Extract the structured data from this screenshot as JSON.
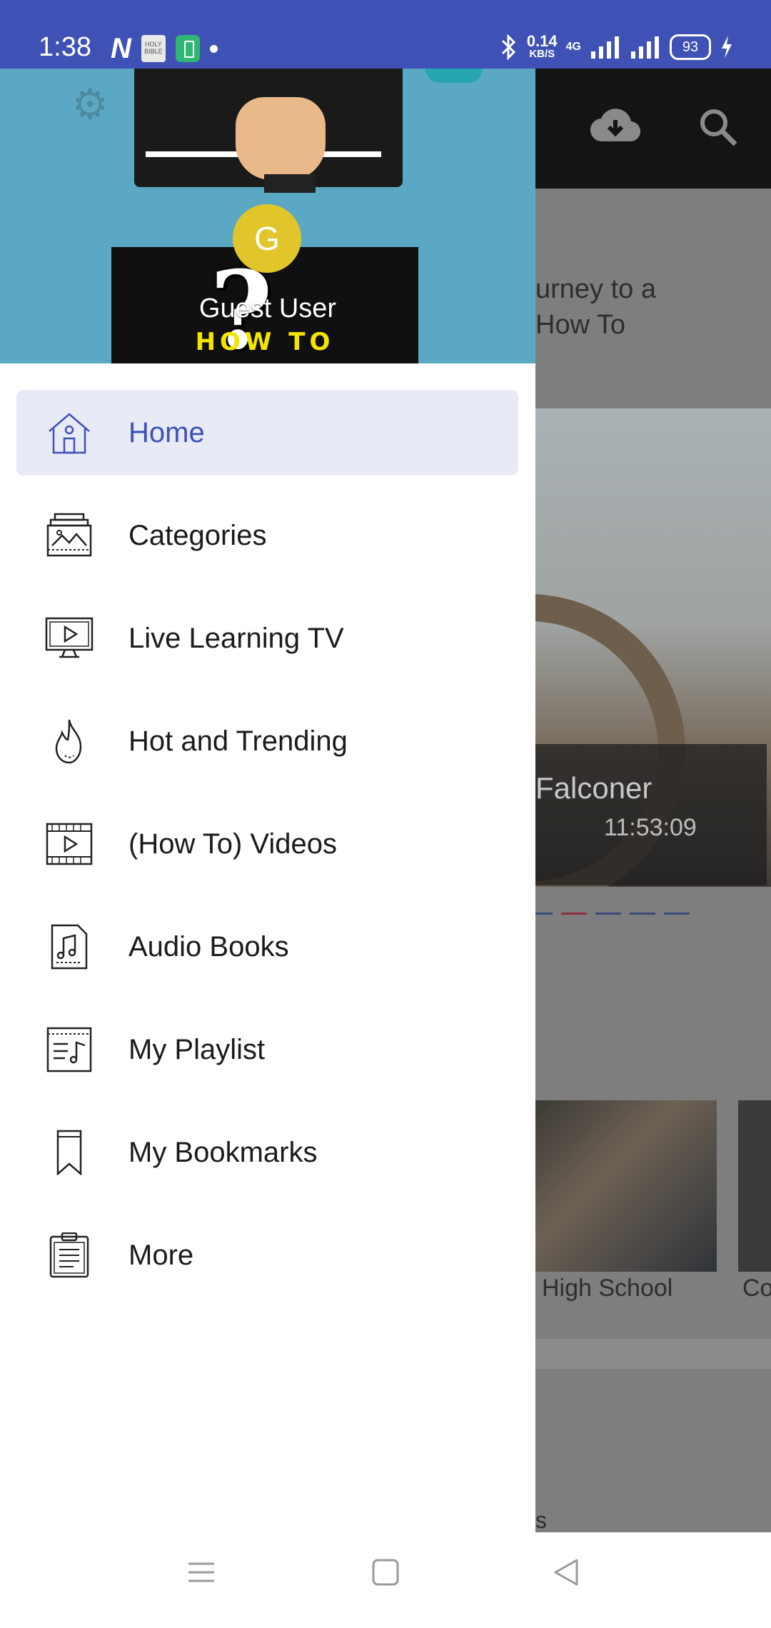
{
  "status_bar": {
    "time": "1:38",
    "left_icons": [
      "n-app-icon",
      "holy-bible-icon",
      "battery-app-icon",
      "notification-dot-icon"
    ],
    "bible_icon_text": "HOLY BIBLE",
    "speed_value": "0.14",
    "speed_unit": "KB/S",
    "network_label": "4G",
    "battery_level": "93",
    "right_icons": [
      "bluetooth-icon",
      "signal-icon",
      "signal-icon",
      "charging-icon"
    ]
  },
  "background_app": {
    "toolbar_icons": [
      "cloud-download-icon",
      "search-icon"
    ],
    "intro_line1": "urney to a",
    "intro_line2": "How To",
    "banner_title": "Falconer",
    "banner_duration": "11:53:09",
    "thumb_label_1": "High School",
    "thumb_label_2": "Co",
    "section_label": "s"
  },
  "drawer": {
    "header": {
      "avatar_letter": "G",
      "user_name": "Guest User",
      "logo_text": "HOW TO"
    },
    "menu": [
      {
        "label": "Home",
        "icon": "home-icon",
        "active": true
      },
      {
        "label": "Categories",
        "icon": "categories-icon",
        "active": false
      },
      {
        "label": "Live Learning TV",
        "icon": "tv-play-icon",
        "active": false
      },
      {
        "label": "Hot and Trending",
        "icon": "flame-icon",
        "active": false
      },
      {
        "label": "(How To) Videos",
        "icon": "film-icon",
        "active": false
      },
      {
        "label": "Audio Books",
        "icon": "music-file-icon",
        "active": false
      },
      {
        "label": "My Playlist",
        "icon": "playlist-icon",
        "active": false
      },
      {
        "label": "My Bookmarks",
        "icon": "bookmark-icon",
        "active": false
      },
      {
        "label": "More",
        "icon": "clipboard-icon",
        "active": false
      }
    ]
  },
  "nav_bar": {
    "buttons": [
      "menu-nav-icon",
      "home-nav-icon",
      "back-nav-icon"
    ]
  },
  "colors": {
    "primary": "#3f51b5",
    "active_item_bg": "#e8eaf6",
    "header_bg": "#5ba8c5",
    "avatar_bg": "#e2c52a",
    "logo_yellow": "#f4e500"
  }
}
